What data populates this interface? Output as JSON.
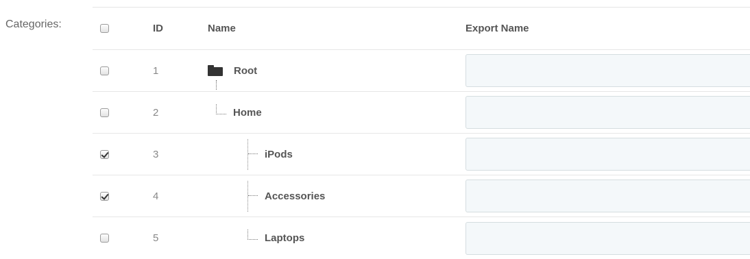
{
  "form": {
    "label": "Categories:"
  },
  "table": {
    "headers": {
      "id": "ID",
      "name": "Name",
      "export_name": "Export Name"
    },
    "header_checked": false,
    "rows": [
      {
        "id": "1",
        "name": "Root",
        "checked": false,
        "export_value": "",
        "icon": "folder-icon"
      },
      {
        "id": "2",
        "name": "Home",
        "checked": false,
        "export_value": ""
      },
      {
        "id": "3",
        "name": "iPods",
        "checked": true,
        "export_value": ""
      },
      {
        "id": "4",
        "name": "Accessories",
        "checked": true,
        "export_value": ""
      },
      {
        "id": "5",
        "name": "Laptops",
        "checked": false,
        "export_value": ""
      }
    ]
  }
}
